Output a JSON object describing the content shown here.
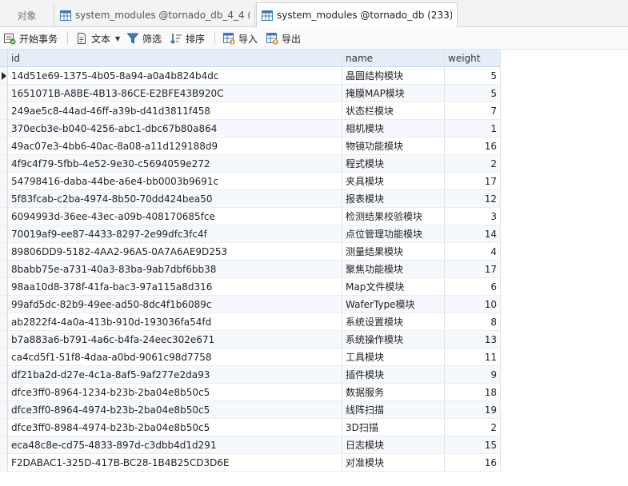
{
  "tabs": {
    "objects_label": "对象",
    "tab1_label": "system_modules @tornado_db_4_4 (...",
    "tab2_label": "system_modules @tornado_db (233)..."
  },
  "toolbar": {
    "begin_transaction": "开始事务",
    "text": "文本",
    "filter": "筛选",
    "sort": "排序",
    "import": "导入",
    "export": "导出"
  },
  "grid": {
    "columns": {
      "id": "id",
      "name": "name",
      "weight": "weight"
    },
    "rows": [
      {
        "id": "14d51e69-1375-4b05-8a94-a0a4b824b4dc",
        "name": "晶圆结构模块",
        "weight": "5"
      },
      {
        "id": "1651071B-A8BE-4B13-86CE-E2BFE43B920C",
        "name": "掩膜MAP模块",
        "weight": "5"
      },
      {
        "id": "249ae5c8-44ad-46ff-a39b-d41d3811f458",
        "name": "状态栏模块",
        "weight": "7"
      },
      {
        "id": "370ecb3e-b040-4256-abc1-dbc67b80a864",
        "name": "相机模块",
        "weight": "1"
      },
      {
        "id": "49ac07e3-4bb6-40ac-8a08-a11d129188d9",
        "name": "物镜功能模块",
        "weight": "16"
      },
      {
        "id": "4f9c4f79-5fbb-4e52-9e30-c5694059e272",
        "name": "程式模块",
        "weight": "2"
      },
      {
        "id": "54798416-daba-44be-a6e4-bb0003b9691c",
        "name": "夹具模块",
        "weight": "17"
      },
      {
        "id": "5f83fcab-c2ba-4974-8b50-70dd424bea50",
        "name": "报表模块",
        "weight": "12"
      },
      {
        "id": "6094993d-36ee-43ec-a09b-408170685fce",
        "name": "检测结果校验模块",
        "weight": "3"
      },
      {
        "id": "70019af9-ee87-4433-8297-2e99dfc3fc4f",
        "name": "点位管理功能模块",
        "weight": "14"
      },
      {
        "id": "89806DD9-5182-4AA2-96A5-0A7A6AE9D253",
        "name": "测量结果模块",
        "weight": "4"
      },
      {
        "id": "8babb75e-a731-40a3-83ba-9ab7dbf6bb38",
        "name": "聚焦功能模块",
        "weight": "17"
      },
      {
        "id": "98aa10d8-378f-41fa-bac3-97a115a8d316",
        "name": "Map文件模块",
        "weight": "6"
      },
      {
        "id": "99afd5dc-82b9-49ee-ad50-8dc4f1b6089c",
        "name": "WaferType模块",
        "weight": "10"
      },
      {
        "id": "ab2822f4-4a0a-413b-910d-193036fa54fd",
        "name": "系统设置模块",
        "weight": "8"
      },
      {
        "id": "b7a883a6-b791-4a6c-b4fa-24eec302e671",
        "name": "系统操作模块",
        "weight": "13"
      },
      {
        "id": "ca4cd5f1-51f8-4daa-a0bd-9061c98d7758",
        "name": "工具模块",
        "weight": "11"
      },
      {
        "id": "df21ba2d-d27e-4c1a-8af5-9af277e2da93",
        "name": "插件模块",
        "weight": "9"
      },
      {
        "id": "dfce3ff0-8964-1234-b23b-2ba04e8b50c5",
        "name": "数据服务",
        "weight": "18"
      },
      {
        "id": "dfce3ff0-8964-4974-b23b-2ba04e8b50c5",
        "name": "线阵扫描",
        "weight": "19"
      },
      {
        "id": "dfce3ff0-8984-4974-b23b-2ba04e8b50c5",
        "name": "3D扫描",
        "weight": "2"
      },
      {
        "id": "eca48c8e-cd75-4833-897d-c3dbb4d1d291",
        "name": "日志模块",
        "weight": "15"
      },
      {
        "id": "F2DABAC1-325D-417B-BC28-1B4B25CD3D6E",
        "name": "对准模块",
        "weight": "16"
      }
    ]
  },
  "colors": {
    "header_bg": "#e3eef8",
    "accent": "#2f6fb7"
  },
  "icons": [
    "table-icon",
    "transaction-icon",
    "text-icon",
    "filter-icon",
    "sort-icon",
    "import-icon",
    "export-icon",
    "row-pointer-icon"
  ]
}
